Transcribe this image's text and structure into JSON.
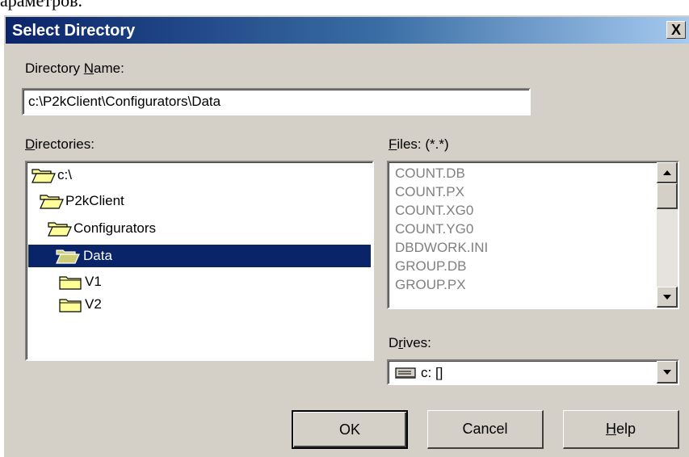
{
  "background_text": "араметров.",
  "dialog": {
    "title": "Select Directory",
    "close_label": "X"
  },
  "directory_name": {
    "label_pre": "Directory ",
    "label_ul": "N",
    "label_post": "ame:",
    "value": "c:\\P2kClient\\Configurators\\Data"
  },
  "directories": {
    "label_ul": "D",
    "label_post": "irectories:",
    "items": [
      {
        "label": "c:\\",
        "icon": "folder-open-icon"
      },
      {
        "label": "P2kClient",
        "icon": "folder-open-icon"
      },
      {
        "label": "Configurators",
        "icon": "folder-open-icon"
      },
      {
        "label": "Data",
        "icon": "folder-open-icon",
        "selected": true
      },
      {
        "label": "V1",
        "icon": "folder-closed-icon"
      },
      {
        "label": "V2",
        "icon": "folder-closed-icon"
      }
    ]
  },
  "files": {
    "label_ul": "F",
    "label_post": "iles: (*.*)",
    "items": [
      "COUNT.DB",
      "COUNT.PX",
      "COUNT.XG0",
      "COUNT.YG0",
      "DBDWORK.INI",
      "GROUP.DB",
      "GROUP.PX"
    ]
  },
  "drives": {
    "label_pre": "D",
    "label_ul": "r",
    "label_post": "ives:",
    "value": "c: []",
    "icon": "drive-icon"
  },
  "buttons": {
    "ok": "OK",
    "cancel": "Cancel",
    "help_ul": "H",
    "help_post": "elp"
  },
  "colors": {
    "selection": "#0a246a",
    "face": "#d4d0c8",
    "disabled_text": "#808080"
  }
}
